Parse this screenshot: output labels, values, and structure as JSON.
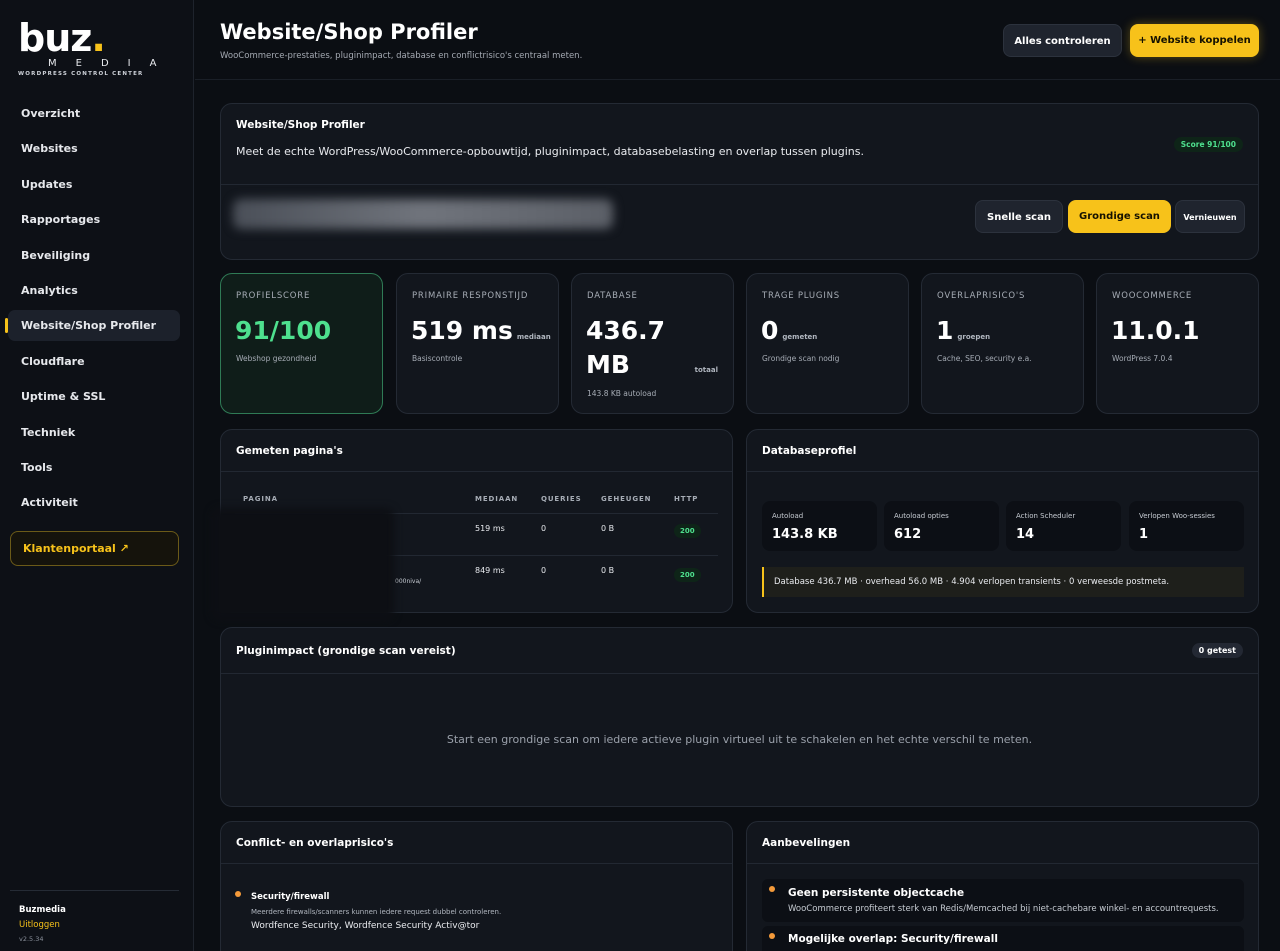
{
  "brand": {
    "logo_main": "buz",
    "logo_dot": ".",
    "logo_media": "MEDIA",
    "logo_sub": "WORDPRESS CONTROL CENTER",
    "accent": "#f7c21a",
    "success": "#4ee08e",
    "warning": "#f49a3a"
  },
  "sidebar": {
    "items": [
      {
        "label": "Overzicht",
        "active": false
      },
      {
        "label": "Websites",
        "active": false
      },
      {
        "label": "Updates",
        "active": false
      },
      {
        "label": "Rapportages",
        "active": false
      },
      {
        "label": "Beveiliging",
        "active": false
      },
      {
        "label": "Analytics",
        "active": false
      },
      {
        "label": "Website/Shop Profiler",
        "active": true
      },
      {
        "label": "Cloudflare",
        "active": false
      },
      {
        "label": "Uptime & SSL",
        "active": false
      },
      {
        "label": "Techniek",
        "active": false
      },
      {
        "label": "Tools",
        "active": false
      },
      {
        "label": "Activiteit",
        "active": false
      }
    ],
    "portal_label": "Klantenportaal ↗",
    "user": "Buzmedia",
    "logout": "Uitloggen",
    "version": "v2.5.34"
  },
  "header": {
    "title": "Website/Shop Profiler",
    "subtitle": "WooCommerce-prestaties, pluginimpact, database en conflictrisico's centraal meten.",
    "check_all": "Alles controleren",
    "connect": "+ Website koppelen"
  },
  "profiler_card": {
    "title": "Website/Shop Profiler",
    "description": "Meet de echte WordPress/WooCommerce-opbouwtijd, pluginimpact, databasebelasting en overlap tussen plugins.",
    "score_badge": "Score 91/100",
    "quick_scan": "Snelle scan",
    "deep_scan": "Grondige scan",
    "refresh": "Vernieuwen"
  },
  "stats": [
    {
      "label": "PROFIELSCORE",
      "value": "91/100",
      "unit": "",
      "sub": "Webshop gezondheid"
    },
    {
      "label": "PRIMAIRE RESPONSTIJD",
      "value": "519 ms",
      "unit": "mediaan",
      "sub": "Basiscontrole"
    },
    {
      "label": "DATABASE",
      "value": "436.7",
      "value2": "MB",
      "unit": "totaal",
      "sub": "143.8 KB autoload"
    },
    {
      "label": "TRAGE PLUGINS",
      "value": "0",
      "unit": "gemeten",
      "sub": "Grondige scan nodig"
    },
    {
      "label": "OVERLAPRISICO'S",
      "value": "1",
      "unit": "groepen",
      "sub": "Cache, SEO, security e.a."
    },
    {
      "label": "WOOCOMMERCE",
      "value": "11.0.1",
      "unit": "",
      "sub": "WordPress 7.0.4"
    }
  ],
  "pages": {
    "title": "Gemeten pagina's",
    "columns": [
      "PAGINA",
      "MEDIAAN",
      "QUERIES",
      "GEHEUGEN",
      "HTTP"
    ],
    "rows": [
      {
        "page_tail": "",
        "median": "519 ms",
        "queries": "0",
        "memory": "0 B",
        "http": "200"
      },
      {
        "page_tail": "000niva/",
        "median": "849 ms",
        "queries": "0",
        "memory": "0 B",
        "http": "200"
      }
    ]
  },
  "database": {
    "title": "Databaseprofiel",
    "tiles": [
      {
        "label": "Autoload",
        "value": "143.8 KB"
      },
      {
        "label": "Autoload opties",
        "value": "612"
      },
      {
        "label": "Action Scheduler",
        "value": "14"
      },
      {
        "label": "Verlopen Woo-sessies",
        "value": "1"
      }
    ],
    "note": "Database 436.7 MB · overhead 56.0 MB · 4.904 verlopen transients · 0 verweesde postmeta."
  },
  "plugin_impact": {
    "title": "Pluginimpact (grondige scan vereist)",
    "badge": "0 getest",
    "empty": "Start een grondige scan om iedere actieve plugin virtueel uit te schakelen en het echte verschil te meten."
  },
  "conflicts": {
    "title": "Conflict- en overlaprisico's",
    "items": [
      {
        "title": "Security/firewall",
        "desc": "Meerdere firewalls/scanners kunnen iedere request dubbel controleren.",
        "plugins": "Wordfence Security, Wordfence Security Activ@tor"
      }
    ]
  },
  "recommendations": {
    "title": "Aanbevelingen",
    "items": [
      {
        "title": "Geen persistente objectcache",
        "desc": "WooCommerce profiteert sterk van Redis/Memcached bij niet-cachebare winkel- en accountrequests."
      },
      {
        "title": "Mogelijke overlap: Security/firewall",
        "desc": ""
      }
    ]
  }
}
